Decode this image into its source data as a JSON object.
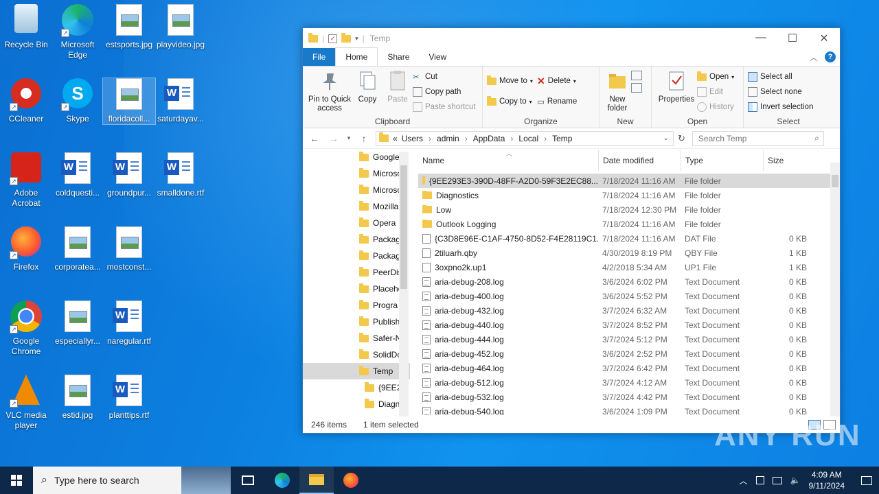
{
  "desktop": {
    "icons": [
      {
        "label": "Recycle Bin"
      },
      {
        "label": "Microsoft Edge"
      },
      {
        "label": "estsports.jpg"
      },
      {
        "label": "playvideo.jpg"
      },
      {
        "label": "CCleaner"
      },
      {
        "label": "Skype"
      },
      {
        "label": "floridacoll..."
      },
      {
        "label": "saturdayav..."
      },
      {
        "label": "Adobe Acrobat"
      },
      {
        "label": "coldquesti..."
      },
      {
        "label": "groundpur..."
      },
      {
        "label": "smalldone.rtf"
      },
      {
        "label": "Firefox"
      },
      {
        "label": "corporatea..."
      },
      {
        "label": "mostconst..."
      },
      {
        "label": "Google Chrome"
      },
      {
        "label": "especiallyr..."
      },
      {
        "label": "naregular.rtf"
      },
      {
        "label": "VLC media player"
      },
      {
        "label": "estid.jpg"
      },
      {
        "label": "planttips.rtf"
      }
    ]
  },
  "window": {
    "title": "Temp",
    "tabs": [
      "File",
      "Home",
      "Share",
      "View"
    ],
    "ribbon": {
      "clipboard": {
        "label": "Clipboard",
        "pin": "Pin to Quick access",
        "copy": "Copy",
        "paste": "Paste",
        "cut": "Cut",
        "copy_path": "Copy path",
        "paste_shortcut": "Paste shortcut"
      },
      "organize": {
        "label": "Organize",
        "move_to": "Move to",
        "copy_to": "Copy to",
        "delete": "Delete",
        "rename": "Rename"
      },
      "new": {
        "label": "New",
        "new_folder": "New folder"
      },
      "open": {
        "label": "Open",
        "properties": "Properties",
        "open": "Open",
        "edit": "Edit",
        "history": "History"
      },
      "select": {
        "label": "Select",
        "select_all": "Select all",
        "select_none": "Select none",
        "invert": "Invert selection"
      }
    },
    "address": {
      "prefix": "«",
      "crumbs": [
        "Users",
        "admin",
        "AppData",
        "Local",
        "Temp"
      ]
    },
    "search_placeholder": "Search Temp",
    "nav_items": [
      {
        "label": "Google"
      },
      {
        "label": "Microso"
      },
      {
        "label": "Microso"
      },
      {
        "label": "Mozilla"
      },
      {
        "label": "Opera"
      },
      {
        "label": "Packag"
      },
      {
        "label": "Packag"
      },
      {
        "label": "PeerDis"
      },
      {
        "label": "Placeho"
      },
      {
        "label": "Progra"
      },
      {
        "label": "Publish"
      },
      {
        "label": "Safer-N"
      },
      {
        "label": "SolidDo"
      },
      {
        "label": "Temp"
      },
      {
        "label": "{9EE29"
      },
      {
        "label": "Diagn"
      }
    ],
    "columns": {
      "name": "Name",
      "date": "Date modified",
      "type": "Type",
      "size": "Size"
    },
    "files": [
      {
        "name": "{9EE293E3-390D-48FF-A2D0-59F3E2EC88...",
        "date": "7/18/2024 11:16 AM",
        "type": "File folder",
        "size": "",
        "kind": "folder"
      },
      {
        "name": "Diagnostics",
        "date": "7/18/2024 11:16 AM",
        "type": "File folder",
        "size": "",
        "kind": "folder"
      },
      {
        "name": "Low",
        "date": "7/18/2024 12:30 PM",
        "type": "File folder",
        "size": "",
        "kind": "folder"
      },
      {
        "name": "Outlook Logging",
        "date": "7/18/2024 11:16 AM",
        "type": "File folder",
        "size": "",
        "kind": "folder"
      },
      {
        "name": "{C3D8E96E-C1AF-4750-8D52-F4E28119C1...",
        "date": "7/18/2024 11:16 AM",
        "type": "DAT File",
        "size": "0 KB",
        "kind": "file"
      },
      {
        "name": "2tiluarh.qby",
        "date": "4/30/2019 8:19 PM",
        "type": "QBY File",
        "size": "1 KB",
        "kind": "file"
      },
      {
        "name": "3oxpno2k.up1",
        "date": "4/2/2018 5:34 AM",
        "type": "UP1 File",
        "size": "1 KB",
        "kind": "file"
      },
      {
        "name": "aria-debug-208.log",
        "date": "3/6/2024 6:02 PM",
        "type": "Text Document",
        "size": "0 KB",
        "kind": "txt"
      },
      {
        "name": "aria-debug-400.log",
        "date": "3/6/2024 5:52 PM",
        "type": "Text Document",
        "size": "0 KB",
        "kind": "txt"
      },
      {
        "name": "aria-debug-432.log",
        "date": "3/7/2024 6:32 AM",
        "type": "Text Document",
        "size": "0 KB",
        "kind": "txt"
      },
      {
        "name": "aria-debug-440.log",
        "date": "3/7/2024 8:52 PM",
        "type": "Text Document",
        "size": "0 KB",
        "kind": "txt"
      },
      {
        "name": "aria-debug-444.log",
        "date": "3/7/2024 5:12 PM",
        "type": "Text Document",
        "size": "0 KB",
        "kind": "txt"
      },
      {
        "name": "aria-debug-452.log",
        "date": "3/6/2024 2:52 PM",
        "type": "Text Document",
        "size": "0 KB",
        "kind": "txt"
      },
      {
        "name": "aria-debug-464.log",
        "date": "3/7/2024 6:42 PM",
        "type": "Text Document",
        "size": "0 KB",
        "kind": "txt"
      },
      {
        "name": "aria-debug-512.log",
        "date": "3/7/2024 4:12 AM",
        "type": "Text Document",
        "size": "0 KB",
        "kind": "txt"
      },
      {
        "name": "aria-debug-532.log",
        "date": "3/7/2024 4:42 PM",
        "type": "Text Document",
        "size": "0 KB",
        "kind": "txt"
      },
      {
        "name": "aria-debug-540.log",
        "date": "3/6/2024 1:09 PM",
        "type": "Text Document",
        "size": "0 KB",
        "kind": "txt"
      }
    ],
    "status": {
      "items": "246 items",
      "selected": "1 item selected"
    }
  },
  "taskbar": {
    "search_placeholder": "Type here to search",
    "time": "4:09 AM",
    "date": "9/11/2024"
  },
  "watermark": "ANY RUN",
  "colors": {
    "accent": "#1979ca",
    "taskbar": "#0d2848",
    "selection": "#d9d9d9"
  }
}
